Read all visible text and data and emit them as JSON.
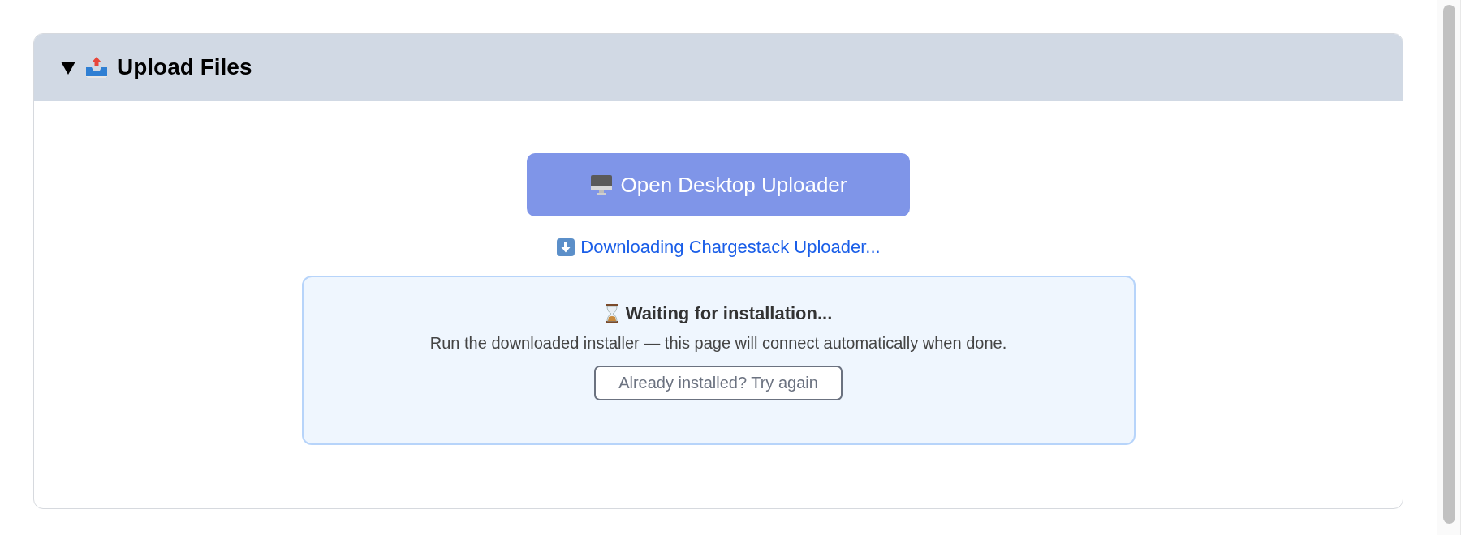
{
  "section": {
    "title": "Upload Files",
    "expanded": true
  },
  "open_button": {
    "label": "Open Desktop Uploader"
  },
  "download_link": {
    "label": "Downloading Chargestack Uploader..."
  },
  "status_box": {
    "heading": "Waiting for installation...",
    "message": "Run the downloaded installer — this page will connect automatically when done.",
    "retry_button": "Already installed? Try again"
  }
}
